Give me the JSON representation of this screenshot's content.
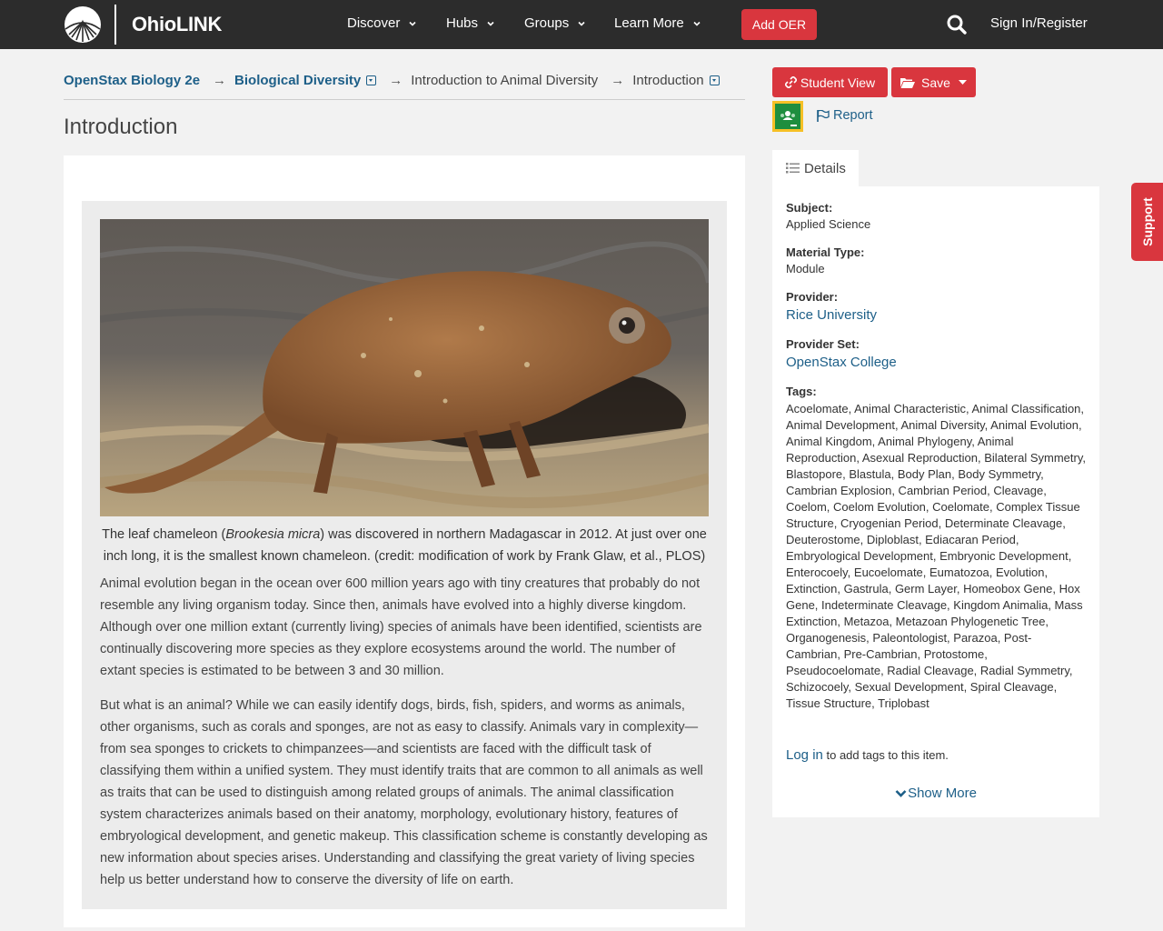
{
  "navbar": {
    "brand": "OhioLINK",
    "menu": [
      {
        "label": "Discover"
      },
      {
        "label": "Hubs"
      },
      {
        "label": "Groups"
      },
      {
        "label": "Learn More"
      }
    ],
    "add_oer": "Add OER",
    "sign_in": "Sign In/Register"
  },
  "breadcrumb": {
    "items": [
      "OpenStax Biology 2e",
      "Biological Diversity",
      "Introduction to Animal Diversity",
      "Introduction"
    ],
    "separator": "→"
  },
  "page": {
    "title": "Introduction",
    "caption_before": "The leaf chameleon (",
    "caption_italic": "Brookesia micra",
    "caption_after": ") was discovered in northern Madagascar in 2012. At just over one inch long, it is the smallest known chameleon. (credit: modification of work by Frank Glaw, et al., PLOS)",
    "paragraph_1": "Animal evolution began in the ocean over 600 million years ago with tiny creatures that probably do not resemble any living organism today. Since then, animals have evolved into a highly diverse kingdom. Although over one million extant (currently living) species of animals have been identified, scientists are continually discovering more species as they explore ecosystems around the world. The number of extant species is estimated to be between 3 and 30 million.",
    "paragraph_2": "But what is an animal? While we can easily identify dogs, birds, fish, spiders, and worms as animals, other organisms, such as corals and sponges, are not as easy to classify. Animals vary in complexity—from sea sponges to crickets to chimpanzees—and scientists are faced with the difficult task of classifying them within a unified system. They must identify traits that are common to all animals as well as traits that can be used to distinguish among related groups of animals. The animal classification system characterizes animals based on their anatomy, morphology, evolutionary history, features of embryological development, and genetic makeup. This classification scheme is constantly developing as new information about species arises. Understanding and classifying the great variety of living species help us better understand how to conserve the diversity of life on earth."
  },
  "actions": {
    "student_view": "Student View",
    "save": "Save",
    "report": "Report"
  },
  "details": {
    "tab_label": "Details",
    "subject_label": "Subject:",
    "subject": "Applied Science",
    "material_type_label": "Material Type:",
    "material_type": "Module",
    "provider_label": "Provider:",
    "provider": "Rice University",
    "provider_set_label": "Provider Set:",
    "provider_set": "OpenStax College",
    "tags_label": "Tags:",
    "tags": "Acoelomate, Animal Characteristic, Animal Classification, Animal Development, Animal Diversity, Animal Evolution, Animal Kingdom, Animal Phylogeny, Animal Reproduction, Asexual Reproduction, Bilateral Symmetry, Blastopore, Blastula, Body Plan, Body Symmetry, Cambrian Explosion, Cambrian Period, Cleavage, Coelom, Coelom Evolution, Coelomate, Complex Tissue Structure, Cryogenian Period, Determinate Cleavage, Deuterostome, Diploblast, Ediacaran Period, Embryological Development, Embryonic Development, Enterocoely, Eucoelomate, Eumatozoa, Evolution, Extinction, Gastrula, Germ Layer, Homeobox Gene, Hox Gene, Indeterminate Cleavage, Kingdom Animalia, Mass Extinction, Metazoa, Metazoan Phylogenetic Tree, Organogenesis, Paleontologist, Parazoa, Post-Cambrian, Pre-Cambrian, Protostome, Pseudocoelomate, Radial Cleavage, Radial Symmetry, Schizocoely, Sexual Development, Spiral Cleavage, Tissue Structure, Triplobast",
    "login_link": "Log in",
    "login_suffix": " to add tags to this item.",
    "show_more": "Show More"
  },
  "support": "Support",
  "colors": {
    "navbar": "#2c2c2c",
    "accent_red": "#d9363e",
    "link_blue": "#1d5f88"
  }
}
